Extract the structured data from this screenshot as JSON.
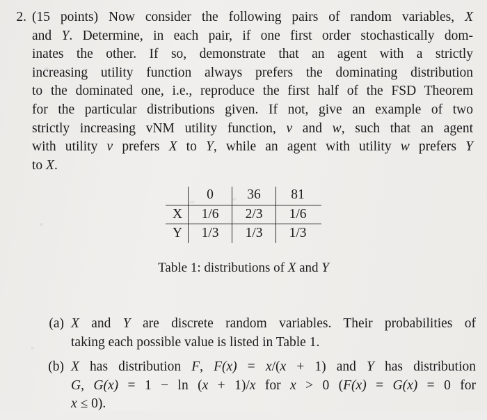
{
  "document": {
    "background_color": "#eeedeb",
    "text_color": "#1b1b1d"
  },
  "problem": {
    "number": "2.",
    "lines": [
      "(15 points) Now consider the following pairs of random variables, X",
      "and Y. Determine, in each pair, if one first order stochastically dom-",
      "inates the other.  If so, demonstrate that an agent with a strictly",
      "increasing utility function always prefers the dominating distribution",
      "to the dominated one, i.e., reproduce the first half of the FSD Theorem",
      "for the particular distributions given.  If not, give an example of two",
      "strictly increasing vNM utility function, v and w, such that an agent",
      "with utility v prefers X to Y, while an agent with utility w prefers Y",
      "to X."
    ],
    "full_text": "2. (15 points) Now consider the following pairs of random variables, X and Y. Determine, in each pair, if one first order stochastically dominates the other. If so, demonstrate that an agent with a strictly increasing utility function always prefers the dominating distribution to the dominated one, i.e., reproduce the first half of the FSD Theorem for the particular distributions given. If not, give an example of two strictly increasing vNM utility function, v and w, such that an agent with utility v prefers X to Y, while an agent with utility w prefers Y to X."
  },
  "table": {
    "corner": "",
    "columns": [
      "0",
      "36",
      "81"
    ],
    "rows": [
      {
        "label": "X",
        "values": [
          "1/6",
          "2/3",
          "1/6"
        ]
      },
      {
        "label": "Y",
        "values": [
          "1/3",
          "1/3",
          "1/3"
        ]
      }
    ],
    "caption": "Table 1: distributions of X and Y"
  },
  "parts": [
    {
      "label": "(a)",
      "lines": [
        "X and Y are discrete random variables.  Their probabilities of",
        "taking each possible value is listed in Table 1."
      ],
      "full_text": "X and Y are discrete random variables. Their probabilities of taking each possible value is listed in Table 1."
    },
    {
      "label": "(b)",
      "lines": [
        "X has distribution F, F(x) = x/(x + 1) and Y has distribution",
        "G, G(x) = 1 − ln (x + 1)/x for x > 0 (F(x) = G(x) = 0 for",
        "x ≤ 0)."
      ],
      "full_text": "X has distribution F, F(x) = x/(x + 1) and Y has distribution G, G(x) = 1 − ln (x + 1)/x for x > 0 (F(x) = G(x) = 0 for x ≤ 0)."
    }
  ]
}
